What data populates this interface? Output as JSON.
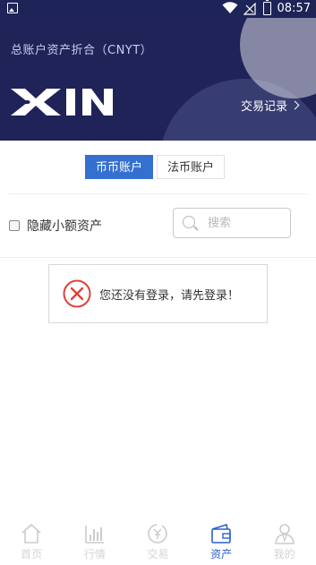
{
  "status_bar": {
    "time": "08:57"
  },
  "header": {
    "title": "总账户资产折合（CNYT）",
    "logo_text": "XIN",
    "trade_record": "交易记录"
  },
  "tabs": [
    {
      "label": "币币账户",
      "active": true
    },
    {
      "label": "法币账户",
      "active": false
    }
  ],
  "filter": {
    "hide_small_label": "隐藏小额资产",
    "hide_small_checked": false,
    "search_placeholder": "搜索"
  },
  "toast": {
    "message": "您还没有登录，请先登录！",
    "icon": "error-x-icon",
    "color": "#e0413b"
  },
  "bottom_nav": [
    {
      "label": "首页",
      "icon": "home-icon",
      "active": false
    },
    {
      "label": "行情",
      "icon": "chart-icon",
      "active": false
    },
    {
      "label": "交易",
      "icon": "exchange-icon",
      "active": false
    },
    {
      "label": "资产",
      "icon": "wallet-icon",
      "active": true
    },
    {
      "label": "我的",
      "icon": "profile-icon",
      "active": false
    }
  ],
  "colors": {
    "header_bg": "#1f2358",
    "accent": "#3470d0"
  }
}
